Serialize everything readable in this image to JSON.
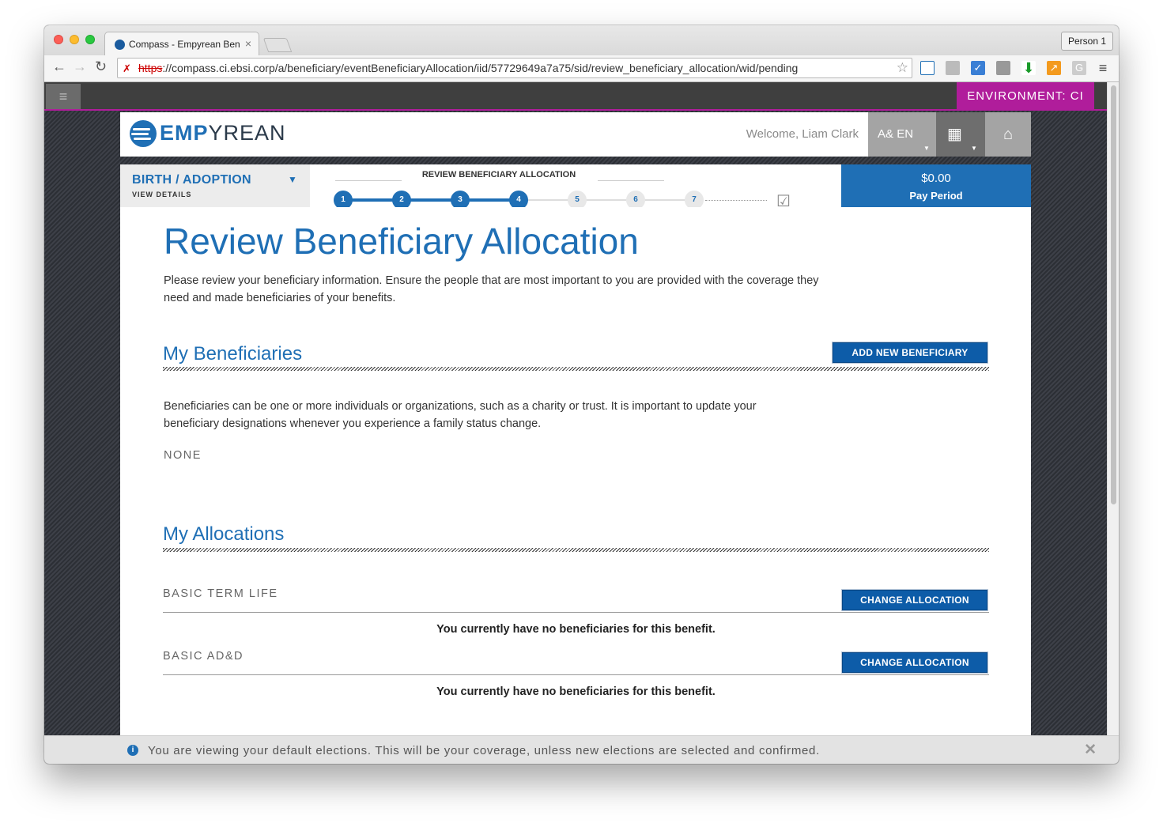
{
  "browser": {
    "tab_title": "Compass - Empyrean Bene",
    "tab_close": "×",
    "person": "Person 1",
    "url_scheme": "https",
    "url_rest": "://compass.ci.ebsi.corp/a/beneficiary/eventBeneficiaryAllocation/iid/57729649a7a75/sid/review_beneficiary_allocation/wid/pending"
  },
  "topbar": {
    "environment": "ENVIRONMENT: CI"
  },
  "header": {
    "logo_bold": "EMP",
    "logo_rest": "YREAN",
    "welcome": "Welcome, Liam Clark",
    "language": "EN"
  },
  "progress": {
    "event_title": "BIRTH / ADOPTION",
    "view_details": "VIEW DETAILS",
    "step_title": "REVIEW BENEFICIARY ALLOCATION",
    "steps": [
      "1",
      "2",
      "3",
      "4",
      "5",
      "6",
      "7"
    ],
    "current_step": 4,
    "pay_amount": "$0.00",
    "pay_period": "Pay Period"
  },
  "content": {
    "title": "Review Beneficiary Allocation",
    "intro": "Please review your beneficiary information. Ensure the people that are most important to you are provided with the coverage they need and made beneficiaries of your benefits.",
    "beneficiaries_heading": "My Beneficiaries",
    "add_button": "ADD NEW BENEFICIARY",
    "beneficiaries_desc": "Beneficiaries can be one or more individuals or organizations, such as a charity or trust. It is important to update your beneficiary designations whenever you experience a family status change.",
    "none_label": "NONE",
    "allocations_heading": "My Allocations",
    "allocations": [
      {
        "name": "BASIC TERM LIFE",
        "button": "CHANGE ALLOCATION",
        "message": "You currently have no beneficiaries for this benefit."
      },
      {
        "name": "BASIC AD&D",
        "button": "CHANGE ALLOCATION",
        "message": "You currently have no beneficiaries for this benefit."
      }
    ]
  },
  "infobar": {
    "message": "You are viewing your default elections. This will be your coverage, unless new elections are selected and confirmed."
  },
  "colors": {
    "brand_blue": "#1f6fb5",
    "environment_magenta": "#b01d9b",
    "button_blue": "#0d5ca8"
  }
}
